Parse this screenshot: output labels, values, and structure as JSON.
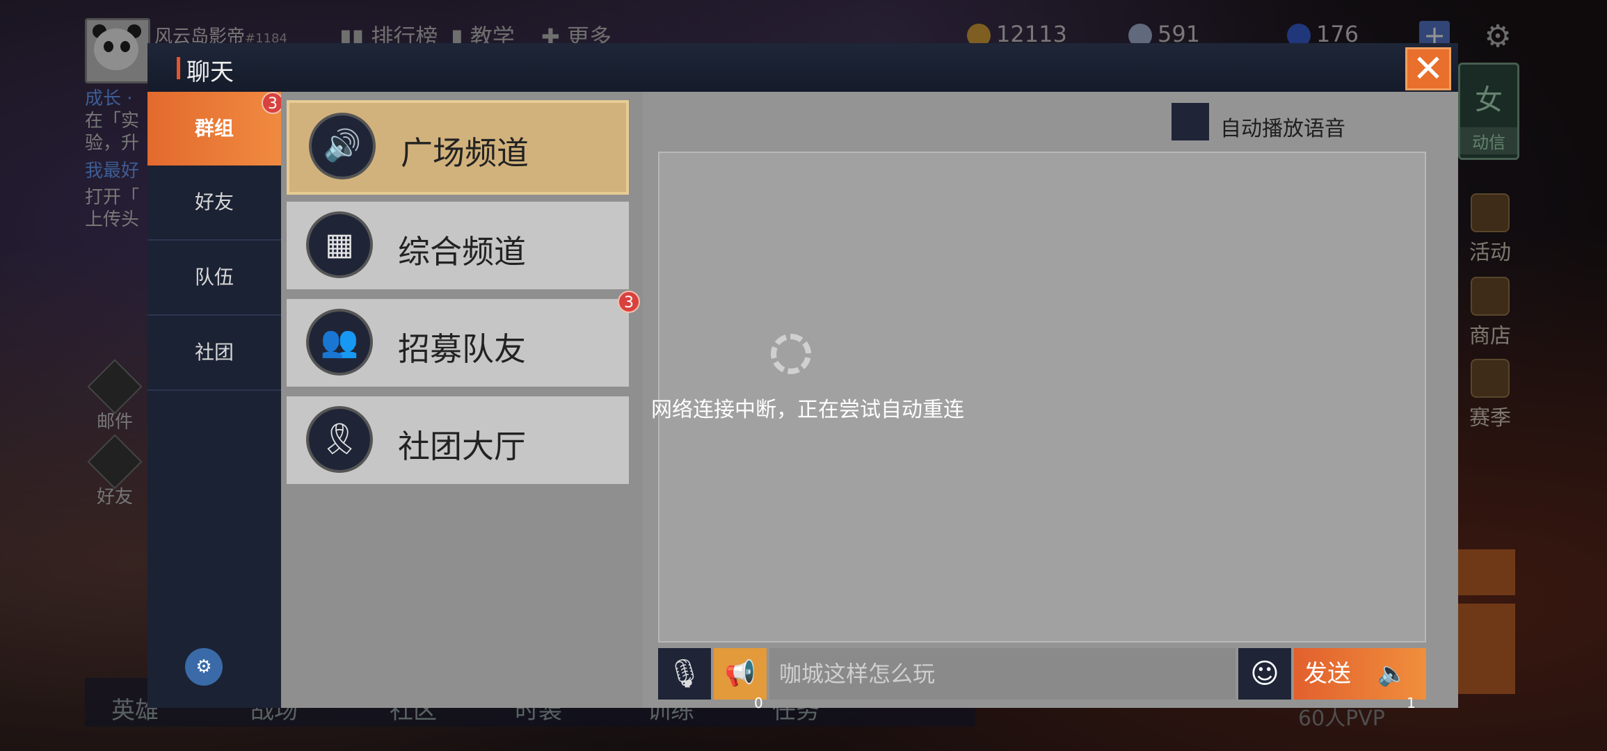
{
  "hud": {
    "player_name": "风云岛影帝",
    "player_id": "#1184",
    "nav": [
      "排行榜",
      "教学",
      "更多"
    ],
    "currency": [
      {
        "value": "12113",
        "color": "#d9a43a"
      },
      {
        "value": "591",
        "color": "#a8b6d6"
      },
      {
        "value": "176",
        "color": "#3a5fd6"
      }
    ],
    "feed": {
      "line1": "成长 ·",
      "line2": "在「实",
      "line3": "验，升",
      "line4": "我最好",
      "line5": "打开「",
      "line6": "上传头"
    },
    "left_icons": [
      "邮件",
      "好友"
    ],
    "right_icons": [
      "活动",
      "商店",
      "赛季"
    ],
    "green_card": {
      "char": "女",
      "tag": "动信"
    },
    "bottom_tabs": [
      "英雄",
      "战场",
      "社区",
      "时装",
      "训练",
      "任务"
    ],
    "pvp": "60人PVP"
  },
  "dialog": {
    "title": "聊天",
    "close_symbol": "✕",
    "tabs": [
      {
        "label": "群组",
        "active": true,
        "badge": "3"
      },
      {
        "label": "好友",
        "active": false
      },
      {
        "label": "队伍",
        "active": false
      },
      {
        "label": "社团",
        "active": false
      }
    ],
    "channels": [
      {
        "label": "广场频道",
        "icon": "speaker-icon",
        "glyph": "🔊",
        "active": true
      },
      {
        "label": "综合频道",
        "icon": "grid-icon",
        "glyph": "▦",
        "active": false
      },
      {
        "label": "招募队友",
        "icon": "users-icon",
        "glyph": "👥",
        "active": false,
        "badge": "3"
      },
      {
        "label": "社团大厅",
        "icon": "banner-icon",
        "glyph": "🎗",
        "active": false
      }
    ],
    "auto_voice_label": "自动播放语音",
    "network_message": "网络连接中断，正在尝试自动重连",
    "input": {
      "placeholder": "咖城这样怎么玩",
      "horn_count": "0",
      "send_label": "发送",
      "send_count": "1"
    }
  },
  "colors": {
    "accent_orange": "#e86f2c",
    "active_channel": "#d2b27c",
    "dialog_dark": "#1b2233"
  }
}
